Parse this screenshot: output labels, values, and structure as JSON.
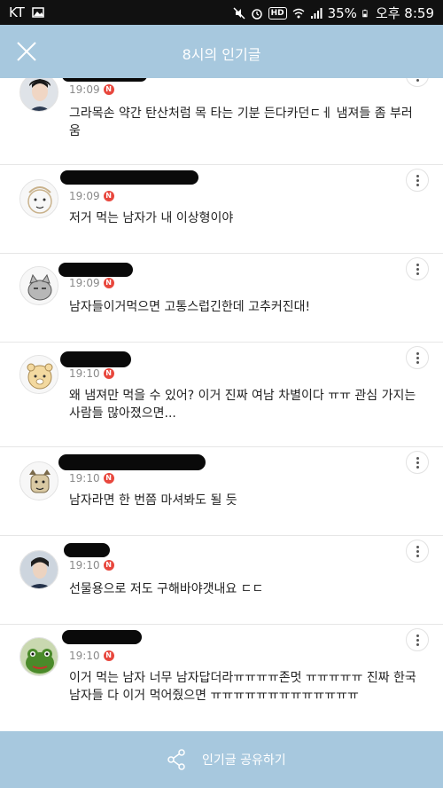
{
  "status_bar": {
    "carrier": "KT",
    "battery": "35%",
    "time": "오후 8:59",
    "hd": "HD"
  },
  "header": {
    "title": "8시의 인기글"
  },
  "comments": [
    {
      "time": "19:09",
      "badge": "N",
      "text": "그라목손 약간 탄산처럼 목 타는 기분 든다카던ㄷㅔ 냄져들 좀 부러움"
    },
    {
      "time": "19:09",
      "badge": "N",
      "text": "저거 먹는 남자가 내 이상형이야"
    },
    {
      "time": "19:09",
      "badge": "N",
      "text": "남자들이거먹으면 고통스럽긴한데 고추커진대!"
    },
    {
      "time": "19:10",
      "badge": "N",
      "text": "왜 냄져만 먹을 수 있어? 이거 진짜 여남 차별이다 ㅠㅠ 관심 가지는 사람들 많아졌으면..."
    },
    {
      "time": "19:10",
      "badge": "N",
      "text": "남자라면 한 번쯤 마셔봐도 될 듯"
    },
    {
      "time": "19:10",
      "badge": "N",
      "text": "선물용으로 저도 구해바야갯내요 ㄷㄷ"
    },
    {
      "time": "19:10",
      "badge": "N",
      "text": "이거 먹는 남자 너무 남자답더라ㅠㅠㅠㅠ존멋 ㅠㅠㅠㅠㅠ 진짜 한국 남자들 다 이거 먹어줬으면 ㅠㅠㅠㅠㅠㅠㅠㅠㅠㅠㅠㅠㅠ"
    }
  ],
  "footer": {
    "share_label": "인기글 공유하기"
  }
}
